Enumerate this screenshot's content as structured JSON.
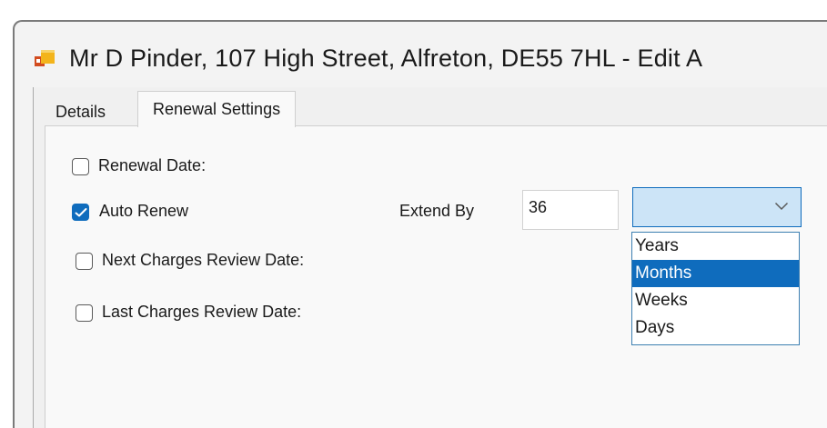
{
  "window": {
    "title": "Mr D Pinder, 107 High Street, Alfreton, DE55 7HL - Edit A",
    "icon": "app-window-icon"
  },
  "tabs": [
    {
      "label": "Details",
      "active": false
    },
    {
      "label": "Renewal Settings",
      "active": true
    }
  ],
  "renewal": {
    "renewal_date": {
      "label": "Renewal Date:",
      "checked": false
    },
    "auto_renew": {
      "label": "Auto Renew",
      "checked": true
    },
    "next_review": {
      "label": "Next Charges Review Date:",
      "checked": false
    },
    "last_review": {
      "label": "Last Charges Review Date:",
      "checked": false
    },
    "extend_by": {
      "label": "Extend By",
      "value": "36"
    },
    "unit_combo": {
      "value": "",
      "options": [
        "Years",
        "Months",
        "Weeks",
        "Days"
      ],
      "highlighted": "Months"
    }
  },
  "colors": {
    "accent": "#0f6cbd",
    "combo_bg": "#cce4f7"
  }
}
